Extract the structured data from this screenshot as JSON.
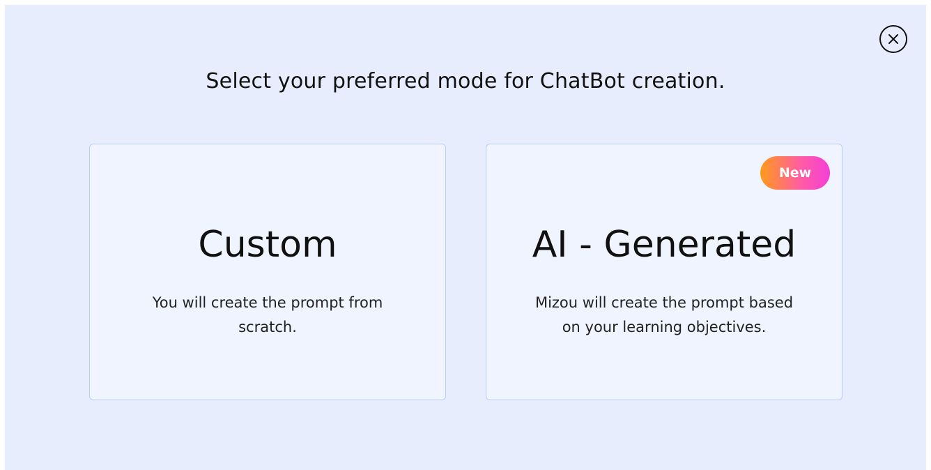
{
  "dialog": {
    "heading": "Select your preferred mode for ChatBot creation.",
    "close_icon": "close-icon"
  },
  "options": [
    {
      "title": "Custom",
      "description": "You will create the prompt from scratch."
    },
    {
      "title": "AI - Generated",
      "description": "Mizou will create the prompt based on your learning objectives.",
      "badge": "New"
    }
  ],
  "colors": {
    "background": "#e8edfd",
    "card_background": "#f0f4ff",
    "card_border": "#b8cdf2",
    "badge_gradient_start": "#ff9b1a",
    "badge_gradient_end": "#f43fd6",
    "text": "#111111"
  }
}
